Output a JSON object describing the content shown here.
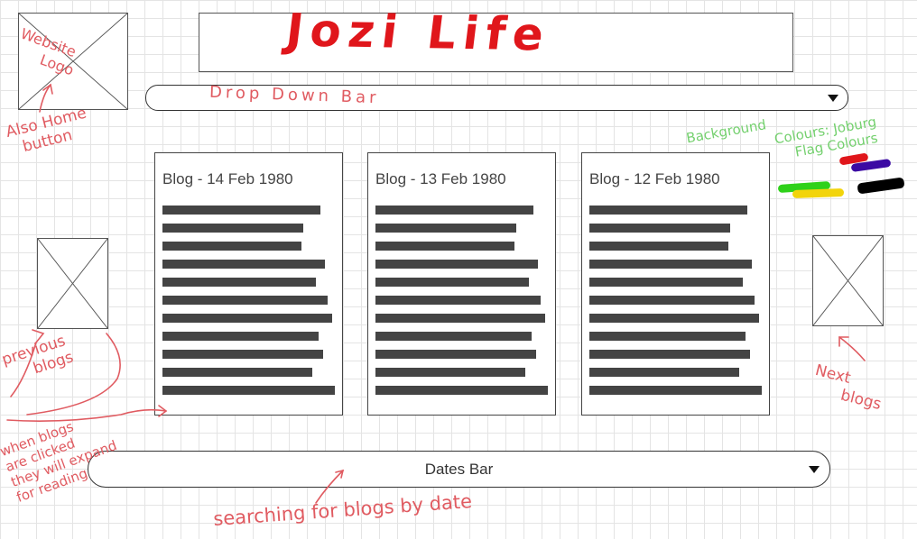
{
  "title": "Jozi Life",
  "nav": {
    "dropdown_placeholder": "Drop Down Bar"
  },
  "blogs": [
    {
      "title": "Blog - 14 Feb 1980"
    },
    {
      "title": "Blog - 13 Feb 1980"
    },
    {
      "title": "Blog - 12 Feb 1980"
    }
  ],
  "dates_bar": {
    "label": "Dates Bar"
  },
  "annotations": {
    "logo": [
      "Website",
      "Logo"
    ],
    "home": [
      "Also Home",
      "button"
    ],
    "background": [
      "Background",
      "Colours: Joburg",
      "Flag Colours"
    ],
    "previous": [
      "previous",
      "blogs"
    ],
    "next": [
      "Next",
      "blogs"
    ],
    "expand": [
      "when blogs",
      "are clicked",
      "they will expand",
      "for reading"
    ],
    "search": "searching for blogs by date"
  },
  "flag_colours": [
    "#e0161b",
    "#3b0aa3",
    "#2fd11a",
    "#f2d40b",
    "#000000"
  ]
}
